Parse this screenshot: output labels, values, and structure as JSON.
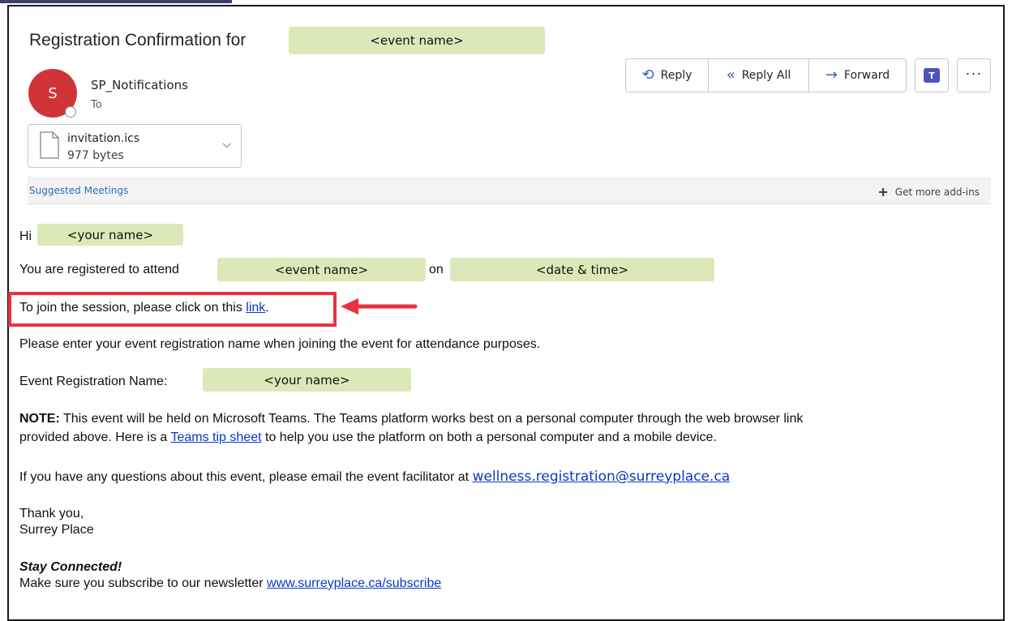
{
  "email": {
    "subject_prefix": "Registration Confirmation for",
    "subject_placeholder": "<event name>",
    "sender": {
      "initial": "S",
      "name": "SP_Notifications",
      "to_label": "To"
    },
    "actions": {
      "reply": "Reply",
      "reply_all": "Reply All",
      "forward": "Forward",
      "more": "···"
    },
    "attachment": {
      "name": "invitation.ics",
      "size": "977 bytes"
    },
    "addins": {
      "suggested": "Suggested Meetings",
      "get_more": "Get more add-ins"
    }
  },
  "body": {
    "greeting": "Hi",
    "your_name_placeholder": "<your name>",
    "registered_text": "You are registered to attend",
    "event_placeholder": "<event name>",
    "on_text": "on",
    "datetime_placeholder": "<date & time>",
    "join_text": "To join the session, please click on this",
    "join_link": "link",
    "join_end": ".",
    "enter_name_text": "Please enter your event registration name when joining the event for attendance purposes.",
    "reg_name_label": "Event Registration Name:",
    "reg_name_placeholder": "<your name>",
    "note_label": "NOTE:",
    "note_line1": "This event will be held on Microsoft Teams. The Teams platform works best on a personal computer through the web browser link",
    "note_line2_prefix": "provided above. Here is a",
    "note_tip_link": "Teams tip sheet",
    "note_line2_suffix": "to help you use the platform on both a personal computer and a mobile device.",
    "questions_text": "If you have any questions about this event, please email the event facilitator at",
    "facilitator_email": "wellness.registration@surreyplace.ca",
    "thanks": "Thank you,",
    "org": "Surrey Place",
    "stay_connected": "Stay Connected!",
    "subscribe_text": "Make sure you subscribe to our newsletter",
    "subscribe_link": "www.surreyplace.ca/subscribe"
  },
  "colors": {
    "highlight": "#dde8b9",
    "callout": "#e8323f",
    "avatar": "#d13438",
    "link": "#0b37c7"
  }
}
